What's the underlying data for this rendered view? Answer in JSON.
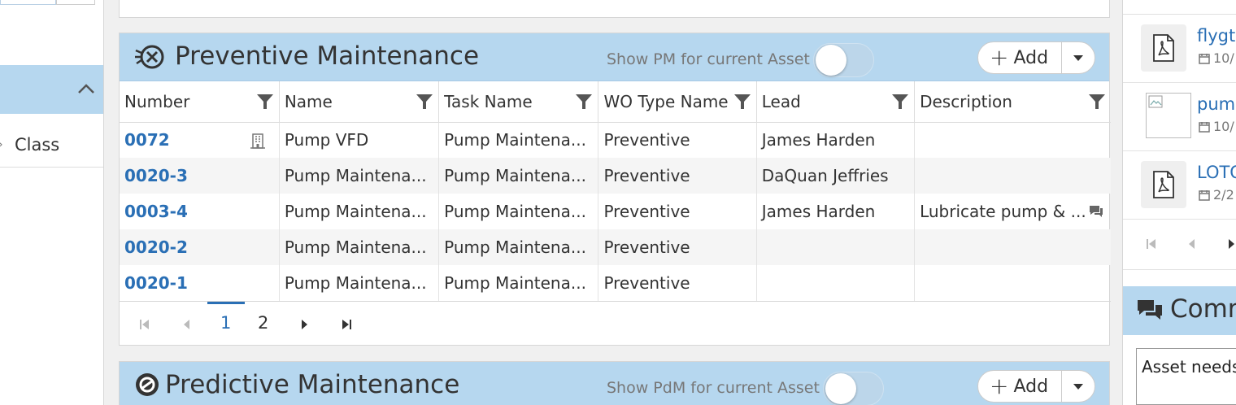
{
  "sidebar": {
    "item_label": "Class"
  },
  "pm": {
    "title": "Preventive Maintenance",
    "toggle_label": "Show PM for current Asset",
    "add_label": "Add",
    "columns": [
      "Number",
      "Name",
      "Task Name",
      "WO Type Name",
      "Lead",
      "Description"
    ],
    "rows": [
      {
        "number": "0072",
        "name": "Pump VFD",
        "task": "Pump Maintena...",
        "wotype": "Preventive",
        "lead": "James Harden",
        "desc": ""
      },
      {
        "number": "0020-3",
        "name": "Pump Maintena...",
        "task": "Pump Maintena...",
        "wotype": "Preventive",
        "lead": "DaQuan Jeffries",
        "desc": ""
      },
      {
        "number": "0003-4",
        "name": "Pump Maintena...",
        "task": "Pump Maintena...",
        "wotype": "Preventive",
        "lead": "James Harden",
        "desc": "Lubricate pump & ..."
      },
      {
        "number": "0020-2",
        "name": "Pump Maintena...",
        "task": "Pump Maintena...",
        "wotype": "Preventive",
        "lead": "",
        "desc": ""
      },
      {
        "number": "0020-1",
        "name": "Pump Maintena...",
        "task": "Pump Maintena...",
        "wotype": "Preventive",
        "lead": "",
        "desc": ""
      }
    ],
    "pages": [
      "1",
      "2"
    ],
    "active_page": "1"
  },
  "pdm": {
    "title": "Predictive Maintenance",
    "toggle_label": "Show PdM for current Asset",
    "add_label": "Add"
  },
  "files": [
    {
      "name": "flygt",
      "date": "10/"
    },
    {
      "name": "pum",
      "date": "10/"
    },
    {
      "name": "LOTO",
      "date": "2/2"
    }
  ],
  "comments": {
    "title": "Comm",
    "text": "Asset needs"
  },
  "colors": {
    "header_bg": "#b6d7ef",
    "link": "#2a6fb5"
  }
}
